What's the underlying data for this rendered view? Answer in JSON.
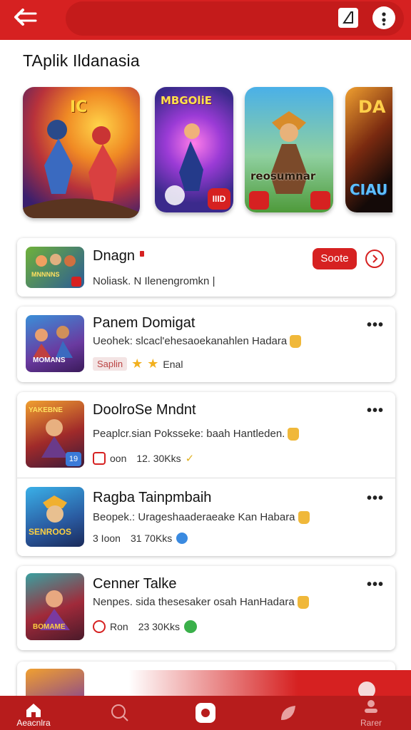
{
  "header": {
    "back_icon": "back-arrow-icon",
    "edit_icon": "edit-icon",
    "more_icon": "more-vertical-icon",
    "bar_color": "#d62121"
  },
  "section_title": "TAplik Ildanasia",
  "carousel": [
    {
      "caption": "IC",
      "icon": "game-art-hero"
    },
    {
      "caption": "MBGOliE",
      "badge": "IIID",
      "icon": "game-art-fighter"
    },
    {
      "caption": "reosumnar",
      "icon": "game-art-warrior"
    },
    {
      "caption": "DA",
      "caption2": "CIAU",
      "icon": "game-art-dark"
    }
  ],
  "featured": {
    "title": "Dnagn",
    "desc": "Noliask. N  Ilenengromkn |",
    "action_label": "Soote",
    "thumb_caption": "MNNNNS",
    "accent": "#d62121"
  },
  "apps": [
    {
      "title": "Panem Domigat",
      "desc": "Ueohek: slcacl'ehesaoekanahlen Hadara",
      "tag": "Saplin",
      "rating_icon": "star-icon",
      "rating_text": "Enal",
      "thumb_caption": "MOMANS"
    },
    {
      "title": "DoolroSe Mndnt",
      "desc": "Peaplcr.sian Poksseke: baah Hantleden.",
      "tag": "oon",
      "meta": "12.  30Kks",
      "thumb_caption": "YAKEBNE",
      "thumb_badge": "19"
    },
    {
      "title": "Ragba Tainpmbaih",
      "desc": "Beopek.: Urageshaaderaeake Kan Habara",
      "tag": "3  Ioon",
      "meta": "31  70Kks",
      "thumb_caption": "SENROOS"
    },
    {
      "title": "Cenner Talke",
      "desc": "Nenpes. sida thesesaker osah HanHadara",
      "tag": "Ron",
      "meta": "23  30Kks",
      "thumb_caption": "BOMAME"
    }
  ],
  "bottom_nav": [
    {
      "label": "Aeacnlra",
      "icon": "home-icon",
      "active": true
    },
    {
      "label": "",
      "icon": "search-icon"
    },
    {
      "label": "",
      "icon": "center-action-icon"
    },
    {
      "label": "",
      "icon": "leaf-icon"
    },
    {
      "label": "Rarer",
      "icon": "profile-icon"
    }
  ]
}
